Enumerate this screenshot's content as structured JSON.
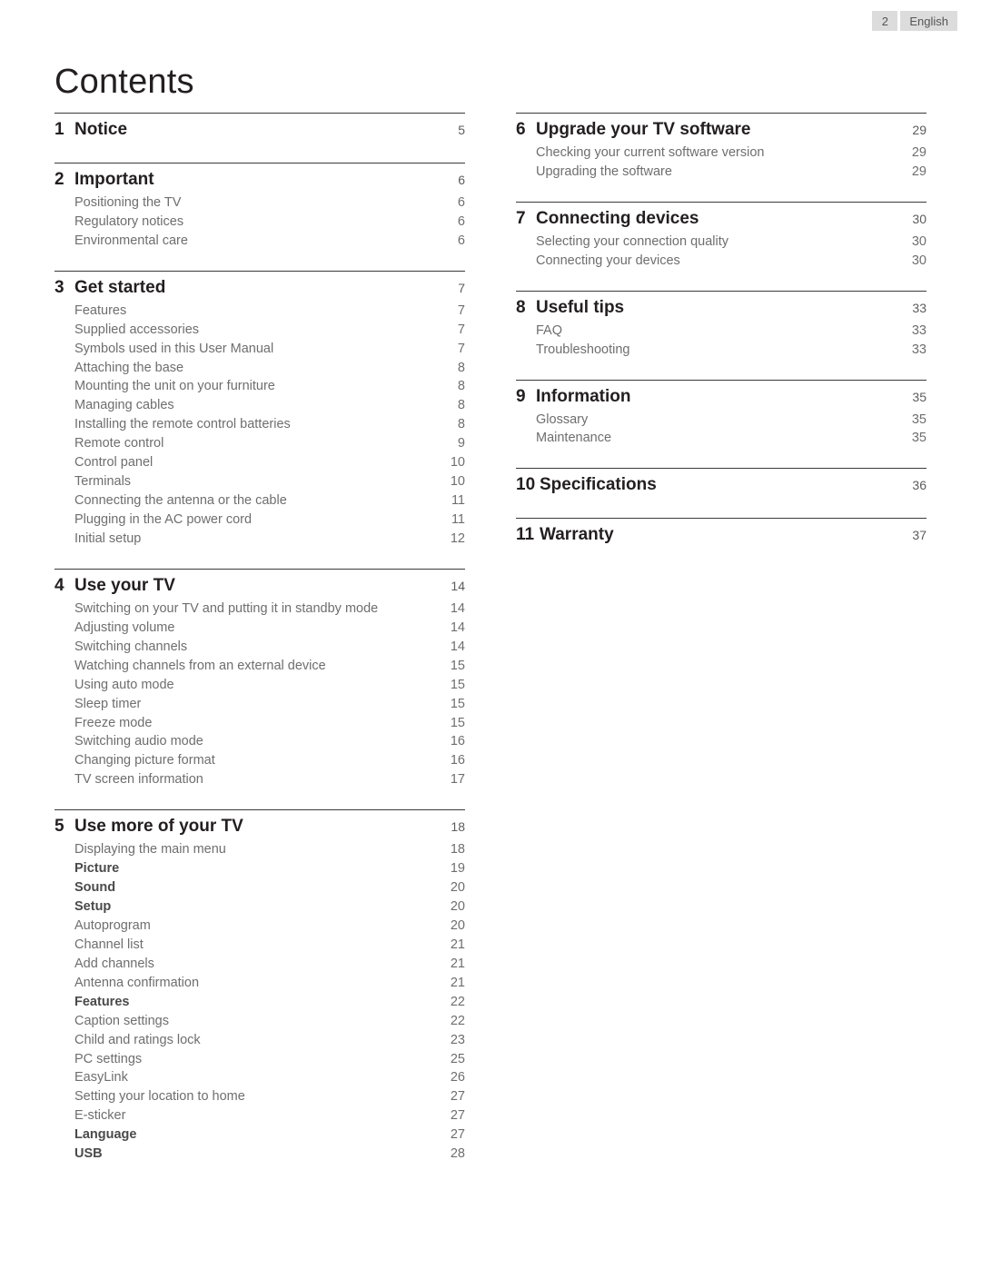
{
  "header": {
    "page_number": "2",
    "language": "English"
  },
  "title": "Contents",
  "columns": [
    {
      "chapters": [
        {
          "number": "1",
          "name": "Notice",
          "page": "5",
          "items": []
        },
        {
          "number": "2",
          "name": "Important",
          "page": "6",
          "items": [
            {
              "name": "Positioning the TV",
              "page": "6",
              "bold": false
            },
            {
              "name": "Regulatory notices",
              "page": "6",
              "bold": false
            },
            {
              "name": "Environmental care",
              "page": "6",
              "bold": false
            }
          ]
        },
        {
          "number": "3",
          "name": "Get started",
          "page": "7",
          "items": [
            {
              "name": "Features",
              "page": "7",
              "bold": false
            },
            {
              "name": "Supplied accessories",
              "page": "7",
              "bold": false
            },
            {
              "name": "Symbols used in this User Manual",
              "page": "7",
              "bold": false
            },
            {
              "name": "Attaching the base",
              "page": "8",
              "bold": false
            },
            {
              "name": "Mounting the unit on your furniture",
              "page": "8",
              "bold": false
            },
            {
              "name": "Managing cables",
              "page": "8",
              "bold": false
            },
            {
              "name": "Installing the remote control batteries",
              "page": "8",
              "bold": false
            },
            {
              "name": "Remote control",
              "page": "9",
              "bold": false
            },
            {
              "name": "Control panel",
              "page": "10",
              "bold": false
            },
            {
              "name": "Terminals",
              "page": "10",
              "bold": false
            },
            {
              "name": "Connecting the antenna or the cable",
              "page": "11",
              "bold": false
            },
            {
              "name": "Plugging in the AC power cord",
              "page": "11",
              "bold": false
            },
            {
              "name": "Initial setup",
              "page": "12",
              "bold": false
            }
          ]
        },
        {
          "number": "4",
          "name": "Use your TV",
          "page": "14",
          "items": [
            {
              "name": "Switching on your TV and putting it in standby mode",
              "page": "14",
              "bold": false
            },
            {
              "name": "Adjusting volume",
              "page": "14",
              "bold": false
            },
            {
              "name": "Switching channels",
              "page": "14",
              "bold": false
            },
            {
              "name": "Watching channels from an external device",
              "page": "15",
              "bold": false
            },
            {
              "name": "Using auto mode",
              "page": "15",
              "bold": false
            },
            {
              "name": "Sleep timer",
              "page": "15",
              "bold": false
            },
            {
              "name": "Freeze mode",
              "page": "15",
              "bold": false
            },
            {
              "name": "Switching audio mode",
              "page": "16",
              "bold": false
            },
            {
              "name": "Changing picture format",
              "page": "16",
              "bold": false
            },
            {
              "name": "TV screen information",
              "page": "17",
              "bold": false
            }
          ]
        },
        {
          "number": "5",
          "name": "Use more of your TV",
          "page": "18",
          "items": [
            {
              "name": "Displaying the main menu",
              "page": "18",
              "bold": false
            },
            {
              "name": "Picture",
              "page": "19",
              "bold": true
            },
            {
              "name": "Sound",
              "page": "20",
              "bold": true
            },
            {
              "name": "Setup",
              "page": "20",
              "bold": true
            },
            {
              "name": "Autoprogram",
              "page": "20",
              "bold": false
            },
            {
              "name": "Channel list",
              "page": "21",
              "bold": false
            },
            {
              "name": "Add channels",
              "page": "21",
              "bold": false
            },
            {
              "name": "Antenna confirmation",
              "page": "21",
              "bold": false
            },
            {
              "name": "Features",
              "page": "22",
              "bold": true
            },
            {
              "name": "Caption settings",
              "page": "22",
              "bold": false
            },
            {
              "name": "Child and ratings lock",
              "page": "23",
              "bold": false
            },
            {
              "name": "PC settings",
              "page": "25",
              "bold": false
            },
            {
              "name": "EasyLink",
              "page": "26",
              "bold": false
            },
            {
              "name": "Setting your location to home",
              "page": "27",
              "bold": false
            },
            {
              "name": "E-sticker",
              "page": "27",
              "bold": false
            },
            {
              "name": "Language",
              "page": "27",
              "bold": true
            },
            {
              "name": "USB",
              "page": "28",
              "bold": true
            }
          ]
        }
      ]
    },
    {
      "chapters": [
        {
          "number": "6",
          "name": "Upgrade your TV software",
          "page": "29",
          "items": [
            {
              "name": "Checking your current software version",
              "page": "29",
              "bold": false
            },
            {
              "name": "Upgrading the software",
              "page": "29",
              "bold": false
            }
          ]
        },
        {
          "number": "7",
          "name": "Connecting devices",
          "page": "30",
          "items": [
            {
              "name": "Selecting your connection quality",
              "page": "30",
              "bold": false
            },
            {
              "name": "Connecting your devices",
              "page": "30",
              "bold": false
            }
          ]
        },
        {
          "number": "8",
          "name": "Useful tips",
          "page": "33",
          "items": [
            {
              "name": "FAQ",
              "page": "33",
              "bold": false
            },
            {
              "name": "Troubleshooting",
              "page": "33",
              "bold": false
            }
          ]
        },
        {
          "number": "9",
          "name": "Information",
          "page": "35",
          "items": [
            {
              "name": "Glossary",
              "page": "35",
              "bold": false
            },
            {
              "name": "Maintenance",
              "page": "35",
              "bold": false
            }
          ]
        },
        {
          "number": "10",
          "name": "Specifications",
          "page": "36",
          "items": []
        },
        {
          "number": "11",
          "name": "Warranty",
          "page": "37",
          "items": []
        }
      ]
    }
  ]
}
